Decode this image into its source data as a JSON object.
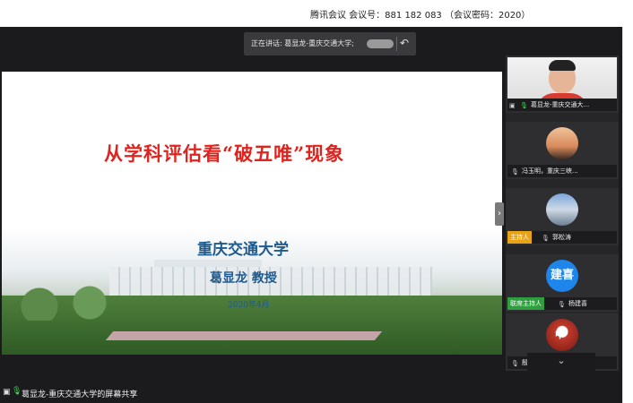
{
  "window": {
    "title": "腾讯会议 会议号：881 182 083 （会议密码：2020）"
  },
  "speaking": {
    "label": "正在讲话: 葛显龙-重庆交通大学;",
    "back_icon": "undo-arrow-icon"
  },
  "slide": {
    "title": "从学科评估看“破五唯”现象",
    "university": "重庆交通大学",
    "author": "葛显龙  教授",
    "date": "2020年4月"
  },
  "participants": [
    {
      "name": "葛显龙-重庆交通大...",
      "role": ""
    },
    {
      "name": "冯玉明，重庆三峡...",
      "role": ""
    },
    {
      "name": "郭松涛",
      "role": "主持人"
    },
    {
      "name": "杨建喜",
      "role": "联席主持人",
      "avatar_text": "建喜"
    },
    {
      "name": "殷泽光",
      "role": "",
      "avatar_text": "中"
    }
  ],
  "status": {
    "share_text": "葛显龙-重庆交通大学的屏幕共享"
  },
  "colors": {
    "slide_title": "#e0231d",
    "slide_text": "#1e5a8e",
    "host_tag": "#e8a317",
    "cohost_tag": "#2e9e3e",
    "mic": "#4cd964"
  }
}
